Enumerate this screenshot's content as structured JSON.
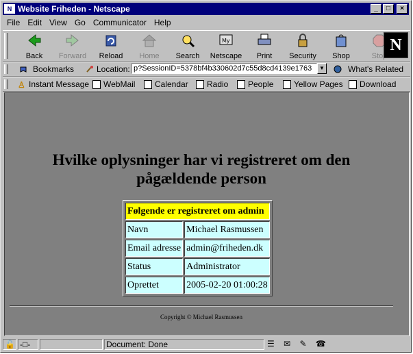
{
  "window": {
    "title": "Website Friheden - Netscape",
    "app_icon": "netscape-icon"
  },
  "menu": [
    "File",
    "Edit",
    "View",
    "Go",
    "Communicator",
    "Help"
  ],
  "toolbar": {
    "back": "Back",
    "forward": "Forward",
    "reload": "Reload",
    "home": "Home",
    "search": "Search",
    "netscape": "Netscape",
    "print": "Print",
    "security": "Security",
    "shop": "Shop",
    "stop": "Stop"
  },
  "location": {
    "bookmarks": "Bookmarks",
    "label": "Location:",
    "url": "p?SessionID=5378bf4b330602d7c55d8cd4139e1763",
    "whats_related": "What's Related"
  },
  "personal": [
    "Instant Message",
    "WebMail",
    "Calendar",
    "Radio",
    "People",
    "Yellow Pages",
    "Download"
  ],
  "page": {
    "heading_line1": "Hvilke oplysninger har vi registreret om den",
    "heading_line2": "pågældende person",
    "table_header": "Følgende er registreret om admin",
    "rows": [
      {
        "label": "Navn",
        "value": "Michael Rasmussen"
      },
      {
        "label": "Email adresse",
        "value": "admin@friheden.dk"
      },
      {
        "label": "Status",
        "value": "Administrator"
      },
      {
        "label": "Oprettet",
        "value": "2005-02-20 01:00:28"
      }
    ],
    "copyright": "Copyright © Michael Rasmussen"
  },
  "status": {
    "text": "Document: Done"
  },
  "colors": {
    "titlebar": "#00007b",
    "chrome": "#c0c0c0",
    "page_bg": "#808080",
    "table_head": "#ffff00",
    "table_cell": "#ccffff"
  }
}
